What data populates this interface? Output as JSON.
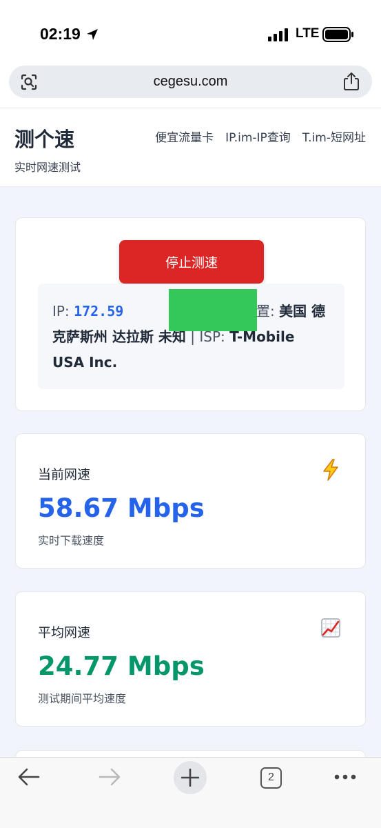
{
  "status_bar": {
    "time": "02:19",
    "network": "LTE"
  },
  "browser": {
    "url": "cegesu.com",
    "tab_count": "2"
  },
  "site": {
    "title": "测个速",
    "subtitle": "实时网速测试",
    "nav": [
      "便宜流量卡",
      "IP.im-IP查询",
      "T.im-短网址"
    ]
  },
  "control": {
    "stop_label": "停止测速",
    "ip_label": "IP:",
    "ip_value": "172.59",
    "location_label": "地理位置:",
    "location_value": "美国 德克萨斯州 达拉斯 未知",
    "isp_separator": "| ISP:",
    "isp_value": "T-Mobile USA Inc."
  },
  "stats": {
    "current": {
      "label": "当前网速",
      "value": "58.67 Mbps",
      "caption": "实时下载速度",
      "icon": "lightning-icon"
    },
    "average": {
      "label": "平均网速",
      "value": "24.77 Mbps",
      "caption": "测试期间平均速度",
      "icon": "chart-increasing-icon"
    }
  },
  "colors": {
    "accent_blue": "#2563eb",
    "accent_green": "#059669",
    "stop_red": "#dc2626",
    "redaction_green": "#34c759"
  }
}
